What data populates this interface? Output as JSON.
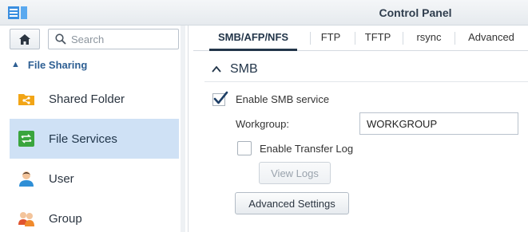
{
  "window": {
    "title": "Control Panel",
    "app_icon": "control-panel-icon"
  },
  "sidebar": {
    "home_icon": "home-icon",
    "search": {
      "placeholder": "Search",
      "value": ""
    },
    "section": {
      "label": "File Sharing",
      "chevron": "chevron-up-icon"
    },
    "items": [
      {
        "label": "Shared Folder",
        "icon": "shared-folder-icon",
        "active": false
      },
      {
        "label": "File Services",
        "icon": "file-services-icon",
        "active": true
      },
      {
        "label": "User",
        "icon": "user-icon",
        "active": false
      },
      {
        "label": "Group",
        "icon": "group-icon",
        "active": false
      }
    ]
  },
  "tabs": [
    {
      "label": "SMB/AFP/NFS",
      "active": true
    },
    {
      "label": "FTP",
      "active": false
    },
    {
      "label": "TFTP",
      "active": false
    },
    {
      "label": "rsync",
      "active": false
    },
    {
      "label": "Advanced",
      "active": false
    }
  ],
  "smb": {
    "header": "SMB",
    "enable_service": {
      "label": "Enable SMB service",
      "checked": true
    },
    "workgroup": {
      "label": "Workgroup:",
      "value": "WORKGROUP"
    },
    "transfer_log": {
      "label": "Enable Transfer Log",
      "checked": false
    },
    "view_logs_label": "View Logs",
    "advanced_settings_label": "Advanced Settings"
  },
  "colors": {
    "accent": "#2e5f93",
    "active_bg": "#cfe1f5",
    "checkmark": "#1e3f66"
  }
}
